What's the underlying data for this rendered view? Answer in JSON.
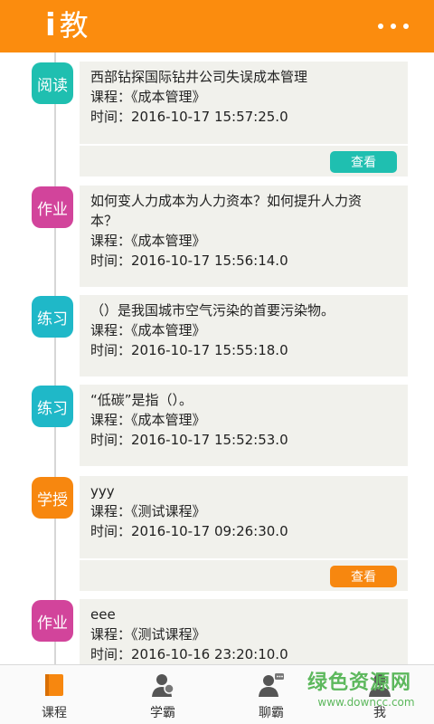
{
  "header": {
    "logo_i": "i",
    "logo_text": "教",
    "menu_icon": "more-dots-icon",
    "bg_color": "#fb8c0e"
  },
  "feed": {
    "items": [
      {
        "badge": "阅读",
        "badge_color": "#1fbfb0",
        "title_lines": [
          "西部钻探国际钻井公司失误成本管理"
        ],
        "course": "课程：《成本管理》",
        "time": "时间：2016-10-17 15:57:25.0",
        "action": "查看",
        "action_color": "#1fbfb0"
      },
      {
        "badge": "作业",
        "badge_color": "#d2449b",
        "title_lines": [
          "如何变人力成本为人力资本？如何提升人力资",
          "本？"
        ],
        "course": "课程：《成本管理》",
        "time": "时间：2016-10-17 15:56:14.0"
      },
      {
        "badge": "练习",
        "badge_color": "#1fb8c8",
        "title_lines": [
          "（）是我国城市空气污染的首要污染物。"
        ],
        "course": "课程：《成本管理》",
        "time": "时间：2016-10-17 15:55:18.0"
      },
      {
        "badge": "练习",
        "badge_color": "#1fb8c8",
        "title_lines": [
          "“低碳”是指（）。"
        ],
        "course": "课程：《成本管理》",
        "time": "时间：2016-10-17 15:52:53.0"
      },
      {
        "badge": "学授",
        "badge_color": "#f7870f",
        "title_lines": [
          "yyy"
        ],
        "course": "课程：《测试课程》",
        "time": "时间：2016-10-17 09:26:30.0",
        "action": "查看",
        "action_color": "#f7870f"
      },
      {
        "badge": "作业",
        "badge_color": "#d2449b",
        "title_lines": [
          "eee"
        ],
        "course": "课程：《测试课程》",
        "time": "时间：2016-10-16 23:20:10.0"
      }
    ]
  },
  "bottom_nav": [
    {
      "label": "课程",
      "icon": "book-icon",
      "active": true
    },
    {
      "label": "学霸",
      "icon": "student-icon",
      "active": false
    },
    {
      "label": "聊霸",
      "icon": "chat-user-icon",
      "active": false
    },
    {
      "label": "我",
      "icon": "user-icon",
      "active": false
    }
  ],
  "watermark": {
    "main": "绿色资源网",
    "sub": "www.downcc.com"
  }
}
